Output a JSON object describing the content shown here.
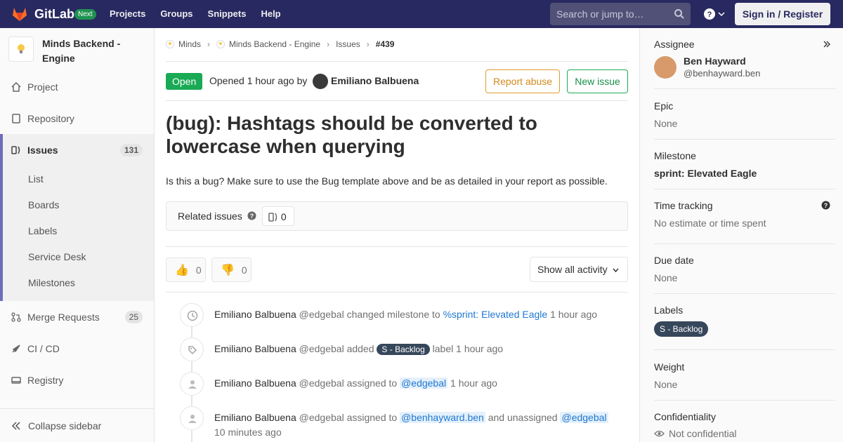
{
  "navbar": {
    "brand": "GitLab",
    "next_badge": "Next",
    "links": [
      "Projects",
      "Groups",
      "Snippets",
      "Help"
    ],
    "search_placeholder": "Search or jump to…",
    "sign_in": "Sign in / Register"
  },
  "sidebar": {
    "project_name": "Minds Backend - Engine",
    "items": {
      "project": "Project",
      "repository": "Repository",
      "issues": "Issues",
      "issues_count": "131",
      "merge_requests": "Merge Requests",
      "mr_count": "25",
      "cicd": "CI / CD",
      "registry": "Registry"
    },
    "sub_items": [
      "List",
      "Boards",
      "Labels",
      "Service Desk",
      "Milestones"
    ],
    "collapse": "Collapse sidebar"
  },
  "breadcrumb": [
    "Minds",
    "Minds Backend - Engine",
    "Issues",
    "#439"
  ],
  "issue": {
    "status": "Open",
    "opened_prefix": "Opened",
    "opened_time": "1 hour ago",
    "opened_by": "by",
    "author": "Emiliano Balbuena",
    "report_abuse": "Report abuse",
    "new_issue": "New issue",
    "title": "(bug): Hashtags should be converted to lowercase when querying",
    "description": "Is this a bug? Make sure to use the Bug template above and be as detailed in your report as possible.",
    "related_title": "Related issues",
    "related_count": "0",
    "thumbs_up": "0",
    "thumbs_down": "0",
    "activity_filter": "Show all activity"
  },
  "timeline": [
    {
      "author": "Emiliano Balbuena",
      "handle": "@edgebal",
      "action": "changed milestone to",
      "target": "%sprint: Elevated Eagle",
      "time": "1 hour ago",
      "icon": "clock-icon"
    },
    {
      "author": "Emiliano Balbuena",
      "handle": "@edgebal",
      "action": "added",
      "label": "S - Backlog",
      "action2": "label",
      "time": "1 hour ago",
      "icon": "tag-icon"
    },
    {
      "author": "Emiliano Balbuena",
      "handle": "@edgebal",
      "action": "assigned to",
      "target": "@edgebal",
      "time": "1 hour ago",
      "icon": "user-icon"
    },
    {
      "author": "Emiliano Balbuena",
      "handle": "@edgebal",
      "action": "assigned to",
      "target": "@benhayward.ben",
      "action2": "and unassigned",
      "target2": "@edgebal",
      "time": "10 minutes ago",
      "icon": "user-icon"
    }
  ],
  "right_sidebar": {
    "assignee_title": "Assignee",
    "assignee_name": "Ben Hayward",
    "assignee_handle": "@benhayward.ben",
    "epic_title": "Epic",
    "epic_value": "None",
    "milestone_title": "Milestone",
    "milestone_value": "sprint: Elevated Eagle",
    "time_title": "Time tracking",
    "time_value": "No estimate or time spent",
    "due_title": "Due date",
    "due_value": "None",
    "labels_title": "Labels",
    "label_value": "S - Backlog",
    "weight_title": "Weight",
    "weight_value": "None",
    "conf_title": "Confidentiality",
    "conf_value": "Not confidential"
  },
  "colors": {
    "navbar": "#292961",
    "open": "#1aaa55",
    "accent": "#6d6dbb",
    "label": "#36475b",
    "link": "#1f78d1"
  }
}
